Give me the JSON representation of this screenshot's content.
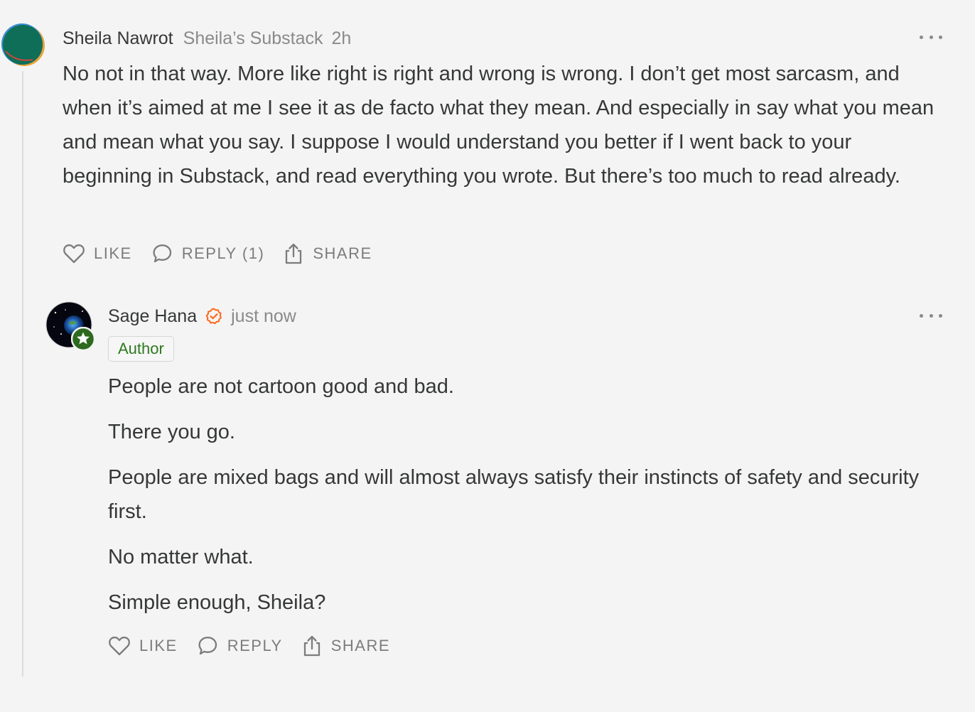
{
  "comments": [
    {
      "author": "Sheila Nawrot",
      "publication": "Sheila’s Substack",
      "time": "2h",
      "body": "No not in that way. More like right is right and wrong is wrong. I don’t get most sarcasm, and when it’s aimed at me I see it as de facto what they mean. And especially in say what you mean and mean what you say. I suppose I would understand you better if I went back to your beginning in Substack, and read everything you wrote. But there’s too much to read already.",
      "actions": {
        "like": "LIKE",
        "reply": "REPLY (1)",
        "share": "SHARE"
      },
      "avatar_colors": {
        "primary": "#0e6e58",
        "accent": "#e8a33a"
      }
    },
    {
      "author": "Sage Hana",
      "time": "just now",
      "badge": "Author",
      "paragraphs": [
        "People are not cartoon good and bad.",
        "There you go.",
        "People are mixed bags and will almost always satisfy their instincts of safety and security first.",
        "No matter what.",
        "Simple enough, Sheila?"
      ],
      "actions": {
        "like": "LIKE",
        "reply": "REPLY",
        "share": "SHARE"
      },
      "verified_color": "#ff6719",
      "author_badge_color": "#2d7a1f"
    }
  ],
  "icons": {
    "like": "heart-icon",
    "reply": "speech-bubble-icon",
    "share": "share-icon",
    "more": "more-dots-icon",
    "verified": "verified-check-icon",
    "author_star": "star-badge-icon"
  }
}
